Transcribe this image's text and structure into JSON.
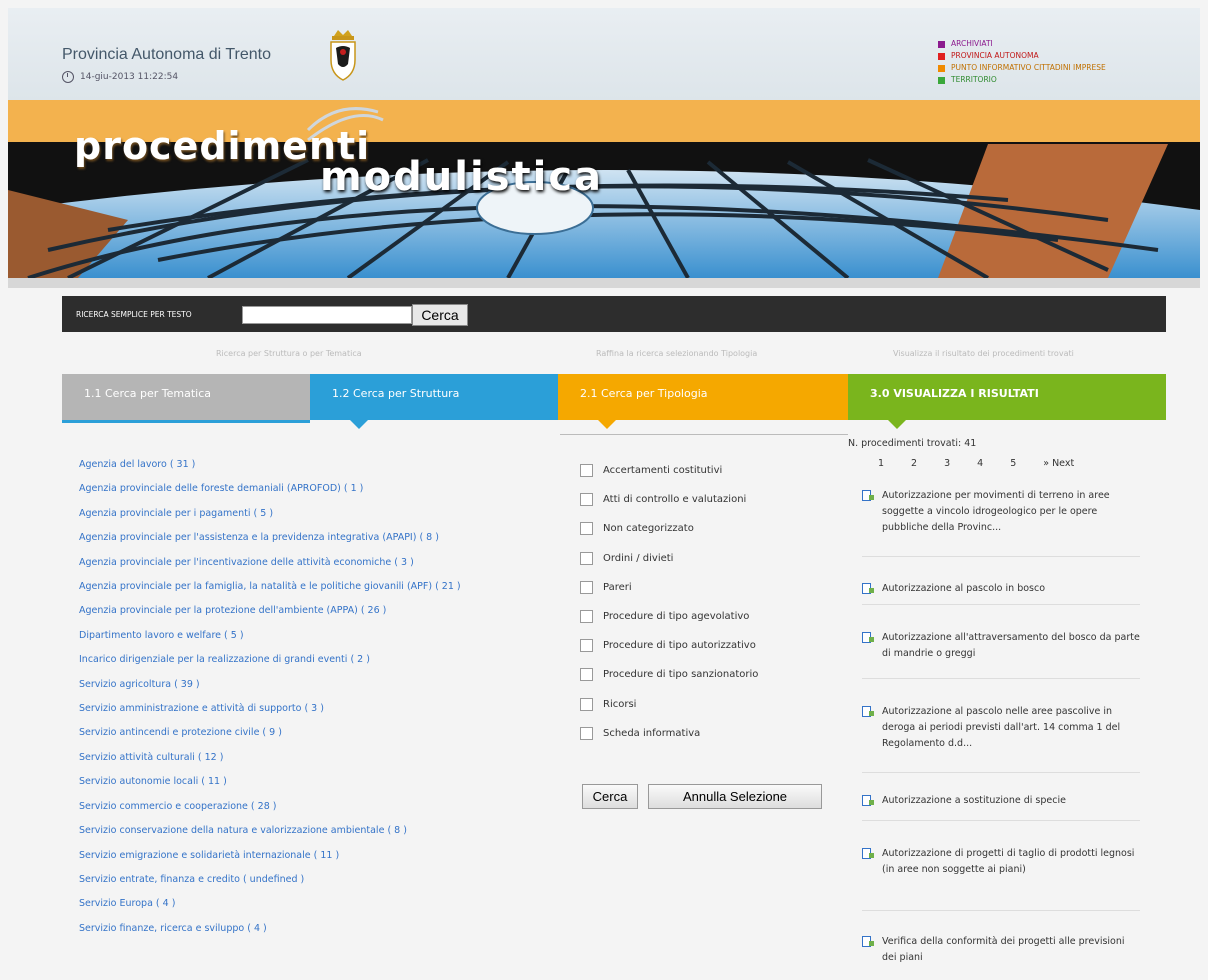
{
  "header": {
    "org_name": "Provincia Autonoma di Trento",
    "datetime": "14-giu-2013 11:22:54",
    "links": [
      {
        "label": "ARCHIVIATI",
        "color": "#8b1a8e"
      },
      {
        "label": "PROVINCIA AUTONOMA",
        "color": "#e02020"
      },
      {
        "label": "PUNTO INFORMATIVO CITTADINI IMPRESE",
        "color": "#f08a00"
      },
      {
        "label": "TERRITORIO",
        "color": "#3aa83a"
      }
    ]
  },
  "banner": {
    "title_part1": "procedimenti",
    "title_part2": "modulistica"
  },
  "search": {
    "label": "RICERCA SEMPLICE PER TESTO",
    "value": "",
    "button": "Cerca"
  },
  "hints": [
    "Ricerca per Struttura o per Tematica",
    "Raffina la ricerca selezionando Tipologia",
    "Visualizza il risultato dei procedimenti trovati"
  ],
  "tabs": [
    {
      "label": "1.1 Cerca per Tematica",
      "color": "#b5b5b5"
    },
    {
      "label": "1.2 Cerca per Struttura",
      "color": "#2b9fd8"
    },
    {
      "label": "2.1 Cerca per Tipologia",
      "color": "#f5a800"
    },
    {
      "label": "3.0 VISUALIZZA I RISULTATI",
      "color": "#7ab51d"
    }
  ],
  "structures": [
    "Agenzia del lavoro ( 31 )",
    "Agenzia provinciale delle foreste demaniali (APROFOD) ( 1 )",
    "Agenzia provinciale per i pagamenti ( 5 )",
    "Agenzia provinciale per l'assistenza e la previdenza integrativa (APAPI) ( 8 )",
    "Agenzia provinciale per l'incentivazione delle attività economiche ( 3 )",
    "Agenzia provinciale per la famiglia, la natalità e le politiche giovanili (APF) ( 21 )",
    "Agenzia provinciale per la protezione dell'ambiente (APPA) ( 26 )",
    "Dipartimento lavoro e welfare ( 5 )",
    "Incarico dirigenziale per la realizzazione di grandi eventi ( 2 )",
    "Servizio agricoltura ( 39 )",
    "Servizio amministrazione e attività di supporto ( 3 )",
    "Servizio antincendi e protezione civile ( 9 )",
    "Servizio attività culturali ( 12 )",
    "Servizio autonomie locali ( 11 )",
    "Servizio commercio e cooperazione ( 28 )",
    "Servizio conservazione della natura e valorizzazione ambientale ( 8 )",
    "Servizio emigrazione e solidarietà internazionale ( 11 )",
    "Servizio entrate, finanza e credito ( undefined )",
    "Servizio Europa ( 4 )",
    "Servizio finanze, ricerca e sviluppo ( 4 )"
  ],
  "types": [
    "Accertamenti costitutivi",
    "Atti di controllo e valutazioni",
    "Non categorizzato",
    "Ordini / divieti",
    "Pareri",
    "Procedure di tipo agevolativo",
    "Procedure di tipo autorizzativo",
    "Procedure di tipo sanzionatorio",
    "Ricorsi",
    "Scheda informativa"
  ],
  "actions": {
    "search": "Cerca",
    "reset": "Annulla Selezione"
  },
  "results": {
    "count_text": "N. procedimenti trovati: 41",
    "pages": [
      "1",
      "2",
      "3",
      "4",
      "5",
      "» Next"
    ],
    "items": [
      "Autorizzazione per movimenti di terreno in aree soggette a vincolo idrogeologico per le opere pubbliche della Provinc...",
      "Autorizzazione al pascolo in bosco",
      "Autorizzazione all'attraversamento del bosco da parte di mandrie o greggi",
      "Autorizzazione al pascolo nelle aree pascolive in deroga ai periodi previsti dall'art. 14 comma 1 del Regolamento d.d...",
      "Autorizzazione a sostituzione di specie",
      "Autorizzazione di progetti di taglio di prodotti legnosi (in aree non soggette ai piani)",
      "Verifica della conformità dei progetti alle previsioni dei piani"
    ]
  }
}
